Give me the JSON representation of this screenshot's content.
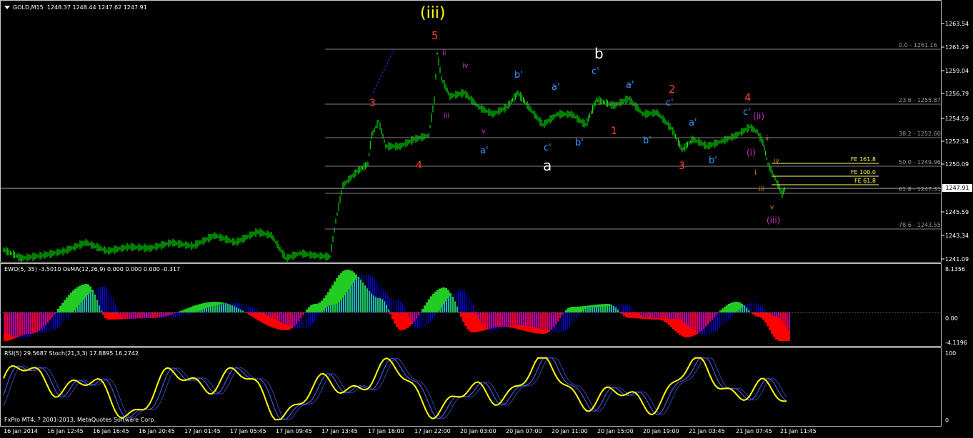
{
  "main": {
    "symbol_label": "GOLD,M15",
    "ohlc": "1248.37 1248.44 1247.62 1247.91",
    "current_price": "1247.91",
    "price_labels": [
      "1263.54",
      "1261.29",
      "1259.04",
      "1256.79",
      "1254.59",
      "1252.34",
      "1250.09",
      "1245.59",
      "1243.34",
      "1241.09"
    ],
    "fib_levels": [
      {
        "label": "0.0 - 1261.16"
      },
      {
        "label": "23.6 - 1255.87"
      },
      {
        "label": "38.2 - 1252.60"
      },
      {
        "label": "50.0 - 1249.96"
      },
      {
        "label": "61.8 - 1247.31"
      },
      {
        "label": "78.6 - 1243.55"
      }
    ],
    "fe_levels": [
      "FE 161.8",
      "FE 100.0",
      "FE 61.8"
    ],
    "wave_labels": [
      {
        "text": "(iii)",
        "color": "#ffff00"
      },
      {
        "text": "5",
        "color": "#ff4422"
      },
      {
        "text": "3",
        "color": "#ff4422"
      },
      {
        "text": "4",
        "color": "#ff4422"
      },
      {
        "text": "ii",
        "color": "#cc33cc"
      },
      {
        "text": "iv",
        "color": "#cc33cc"
      },
      {
        "text": "iii",
        "color": "#cc33cc"
      },
      {
        "text": "v",
        "color": "#cc33cc"
      },
      {
        "text": "a'",
        "color": "#3399ff"
      },
      {
        "text": "b'",
        "color": "#3399ff"
      },
      {
        "text": "c'",
        "color": "#3399ff"
      },
      {
        "text": "a'",
        "color": "#3399ff"
      },
      {
        "text": "c'",
        "color": "#3399ff"
      },
      {
        "text": "b'",
        "color": "#3399ff"
      },
      {
        "text": "b",
        "color": "#ffffff"
      },
      {
        "text": "a",
        "color": "#ffffff"
      },
      {
        "text": "1",
        "color": "#ff4422"
      },
      {
        "text": "a'",
        "color": "#3399ff"
      },
      {
        "text": "b'",
        "color": "#3399ff"
      },
      {
        "text": "2",
        "color": "#ff4422"
      },
      {
        "text": "c'",
        "color": "#3399ff"
      },
      {
        "text": "a'",
        "color": "#3399ff"
      },
      {
        "text": "3",
        "color": "#ff4422"
      },
      {
        "text": "b'",
        "color": "#3399ff"
      },
      {
        "text": "4",
        "color": "#ff4422"
      },
      {
        "text": "c'",
        "color": "#3399ff"
      },
      {
        "text": "(ii)",
        "color": "#cc33cc"
      },
      {
        "text": "(i)",
        "color": "#cc33cc"
      },
      {
        "text": "ii",
        "color": "#cc8822"
      },
      {
        "text": "iv",
        "color": "#cc8822"
      },
      {
        "text": "i",
        "color": "#cc8822"
      },
      {
        "text": "iii",
        "color": "#cc8822"
      },
      {
        "text": "v",
        "color": "#cc8822"
      },
      {
        "text": "(iii)",
        "color": "#cc33cc"
      }
    ]
  },
  "ewo": {
    "label": "EWO(5, 35) -3.5010  OsMA(12,26,9) 0.000 0.000 0.000 -0.317",
    "axis": [
      "8.1356",
      "0.00",
      "-4.1196"
    ]
  },
  "rsi": {
    "label": "RSI(5) 29.5687  Stoch(21,3,3) 17.8895 16.2742",
    "axis": [
      "100",
      "0"
    ]
  },
  "footer": "FxPro MT4, ? 2001-2013, MetaQuotes Software Corp.",
  "time_labels": [
    "16 Jan 2014",
    "16 Jan 12:45",
    "16 Jan 16:45",
    "16 Jan 20:45",
    "17 Jan 01:45",
    "17 Jan 05:45",
    "17 Jan 09:45",
    "17 Jan 13:45",
    "17 Jan 18:00",
    "17 Jan 22:00",
    "20 Jan 03:00",
    "20 Jan 07:00",
    "20 Jan 11:00",
    "20 Jan 15:00",
    "20 Jan 19:00",
    "21 Jan 03:45",
    "21 Jan 07:45",
    "21 Jan 11:45"
  ],
  "colors": {
    "candle": "#00ff00",
    "ewo_pos": "#22cc22",
    "ewo_neg": "#ff0000",
    "osma": "#0000ff",
    "rsi": "#ffff00",
    "stoch": "#5566ff",
    "fib_line": "#808080",
    "fe_line": "#ffff66"
  }
}
